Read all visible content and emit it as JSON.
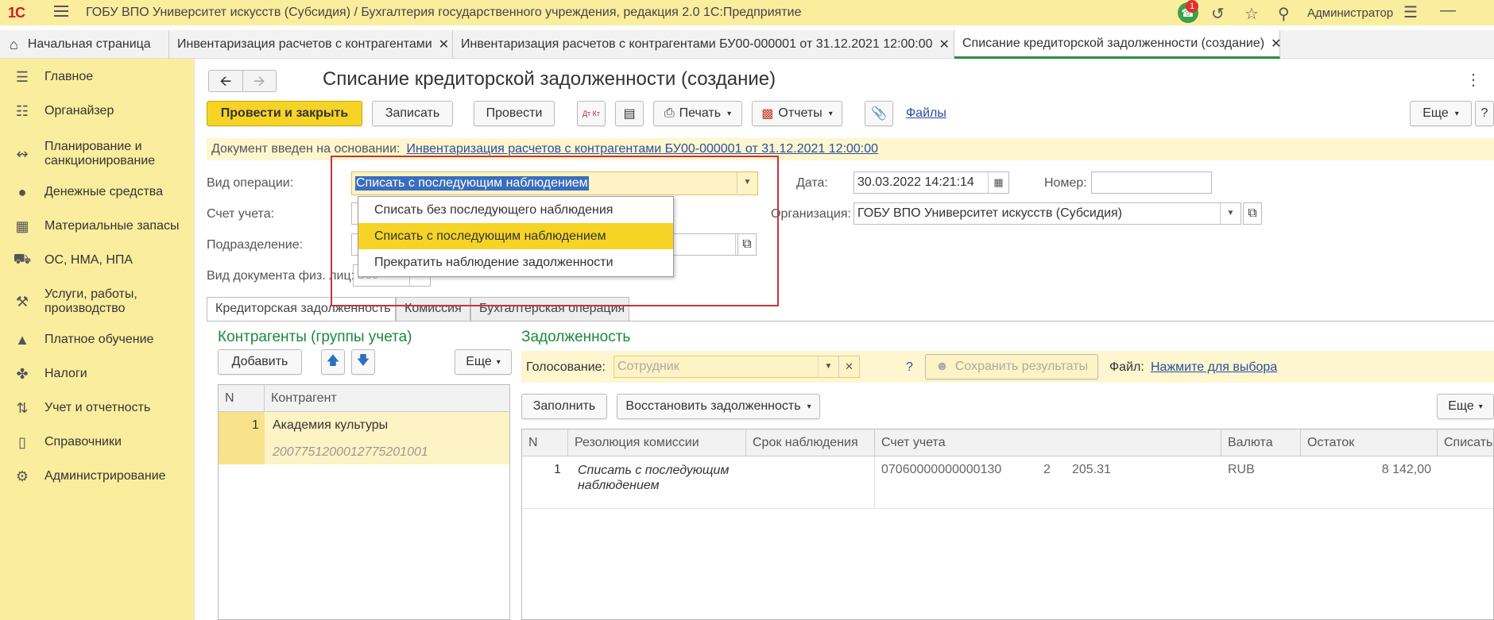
{
  "topbar": {
    "logo": "1С",
    "title": "ГОБУ ВПО Университет искусств (Субсидия) / Бухгалтерия государственного учреждения, редакция 2.0 1С:Предприятие",
    "notification_count": "1",
    "user": "Администратор"
  },
  "tabs": [
    {
      "label": "Начальная страница"
    },
    {
      "label": "Инвентаризация расчетов с контрагентами"
    },
    {
      "label": "Инвентаризация расчетов с контрагентами БУ00-000001 от 31.12.2021 12:00:00"
    },
    {
      "label": "Списание кредиторской задолженности (создание)"
    }
  ],
  "sidebar": {
    "items": [
      {
        "label": "Главное",
        "icon": "menu-lines-icon"
      },
      {
        "label": "Органайзер",
        "icon": "clipboard-icon"
      },
      {
        "label": "Планирование и санкционирование",
        "icon": "planning-icon"
      },
      {
        "label": "Денежные средства",
        "icon": "ruble-icon"
      },
      {
        "label": "Материальные запасы",
        "icon": "grid-icon"
      },
      {
        "label": "ОС, НМА, НПА",
        "icon": "truck-icon"
      },
      {
        "label": "Услуги, работы, производство",
        "icon": "tools-icon"
      },
      {
        "label": "Платное обучение",
        "icon": "graduation-cap-icon"
      },
      {
        "label": "Налоги",
        "icon": "coat-of-arms-icon"
      },
      {
        "label": "Учет и отчетность",
        "icon": "chart-icon"
      },
      {
        "label": "Справочники",
        "icon": "books-icon"
      },
      {
        "label": "Администрирование",
        "icon": "gear-icon"
      }
    ]
  },
  "document": {
    "title": "Списание кредиторской задолженности (создание)",
    "toolbar": {
      "post_close": "Провести и закрыть",
      "save": "Записать",
      "post": "Провести",
      "dtkt": "Дт Кт",
      "print": "Печать",
      "reports": "Отчеты",
      "files": "Файлы",
      "more": "Еще",
      "help": "?"
    },
    "basis_label": "Документ введен на основании:",
    "basis_link": "Инвентаризация расчетов с контрагентами БУ00-000001 от 31.12.2021 12:00:00",
    "fields": {
      "operation_label": "Вид операции:",
      "operation_value": "Списать с последующим наблюдением",
      "account_label": "Счет учета:",
      "department_label": "Подразделение:",
      "doc_type_label": "Вид документа физ. лиц:",
      "doc_type_value": "Всё",
      "date_label": "Дата:",
      "date_value": "30.03.2022 14:21:14",
      "number_label": "Номер:",
      "number_value": "",
      "org_label": "Организация:",
      "org_value": "ГОБУ ВПО Университет искусств (Субсидия)"
    },
    "dropdown_options": [
      "Списать без последующего наблюдения",
      "Списать с последующим наблюдением",
      "Прекратить наблюдение задолженности"
    ],
    "inner_tabs": [
      "Кредиторская задолженность",
      "Комиссия",
      "Бухгалтерская операция"
    ],
    "counterparties": {
      "title": "Контрагенты (группы учета)",
      "add": "Добавить",
      "more": "Еще",
      "columns": [
        "N",
        "Контрагент"
      ],
      "rows": [
        {
          "n": "1",
          "name": "Академия культуры",
          "code": "2007751200012775201001"
        }
      ]
    },
    "debt": {
      "title": "Задолженность",
      "vote_label": "Голосование:",
      "vote_placeholder": "Сотрудник",
      "question": "?",
      "save_results": "Сохранить результаты",
      "file_label": "Файл:",
      "file_link": "Нажмите для выбора",
      "fill": "Заполнить",
      "restore": "Восстановить задолженность",
      "more": "Еще",
      "columns": [
        "N",
        "Резолюция комиссии",
        "Срок наблюдения",
        "Счет учета",
        "Валюта",
        "Остаток",
        "Списать"
      ],
      "rows": [
        {
          "n": "1",
          "resolution": "Списать с последующим наблюдением",
          "term": "",
          "account": "07060000000000130",
          "account_2": "2",
          "account_3": "205.31",
          "currency": "RUB",
          "balance": "8 142,00",
          "writeoff": ""
        }
      ]
    }
  },
  "colors": {
    "sidebar_bg": "#fbed9e",
    "primary_button": "#f6d426",
    "section_title": "#1a8a3a",
    "highlight_frame": "#c8323c",
    "link": "#2a4fa0"
  }
}
